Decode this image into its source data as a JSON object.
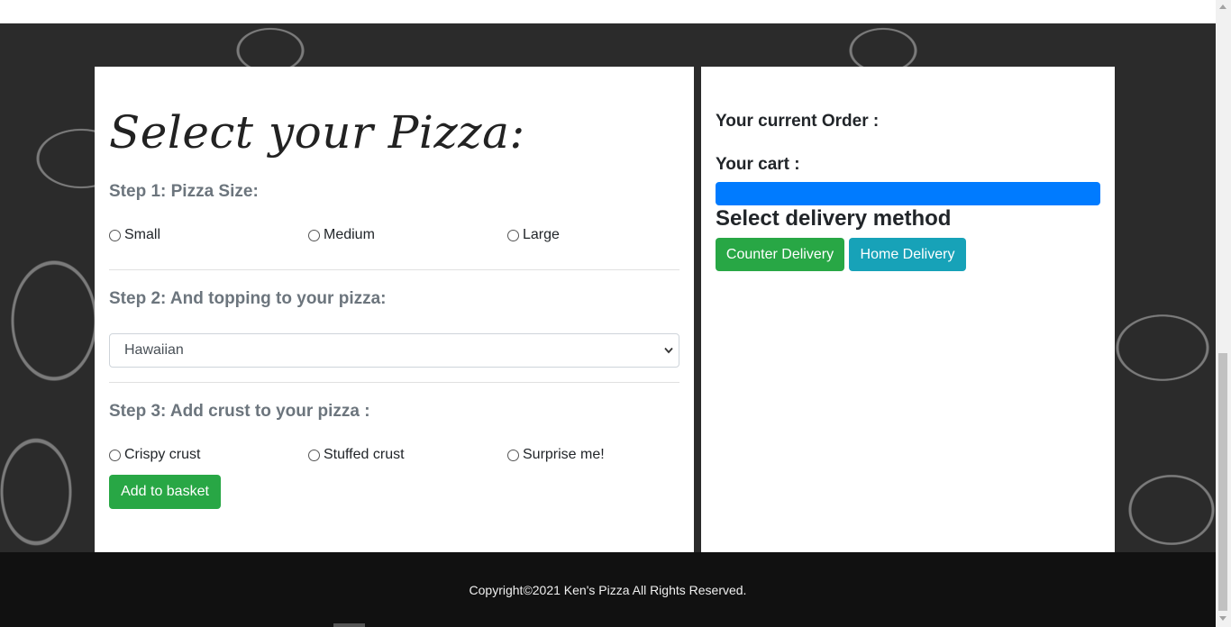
{
  "pizza_form": {
    "title": "Select your Pizza:",
    "step1": {
      "heading": "Step 1: Pizza Size:",
      "options": [
        "Small",
        "Medium",
        "Large"
      ]
    },
    "step2": {
      "heading": "Step 2: And topping to your pizza:",
      "selected_topping": "Hawaiian"
    },
    "step3": {
      "heading": "Step 3: Add crust to your pizza :",
      "options": [
        "Crispy crust",
        "Stuffed crust",
        "Surprise me!"
      ]
    },
    "add_button": "Add to basket"
  },
  "order": {
    "current_order_label": "Your current Order :",
    "cart_label": "Your cart :",
    "delivery_heading": "Select delivery method",
    "counter_button": "Counter Delivery",
    "home_button": "Home Delivery"
  },
  "footer": {
    "copyright": "Copyright©2021 Ken's Pizza All Rights Reserved."
  },
  "colors": {
    "success": "#28a745",
    "primary": "#007bff",
    "info": "#17a2b8",
    "muted": "#6c757d",
    "footer_bg": "#111111",
    "page_bg": "#2b2b2b"
  },
  "icons": [
    "select-chevron-icon",
    "scroll-up-icon",
    "scroll-down-icon"
  ]
}
